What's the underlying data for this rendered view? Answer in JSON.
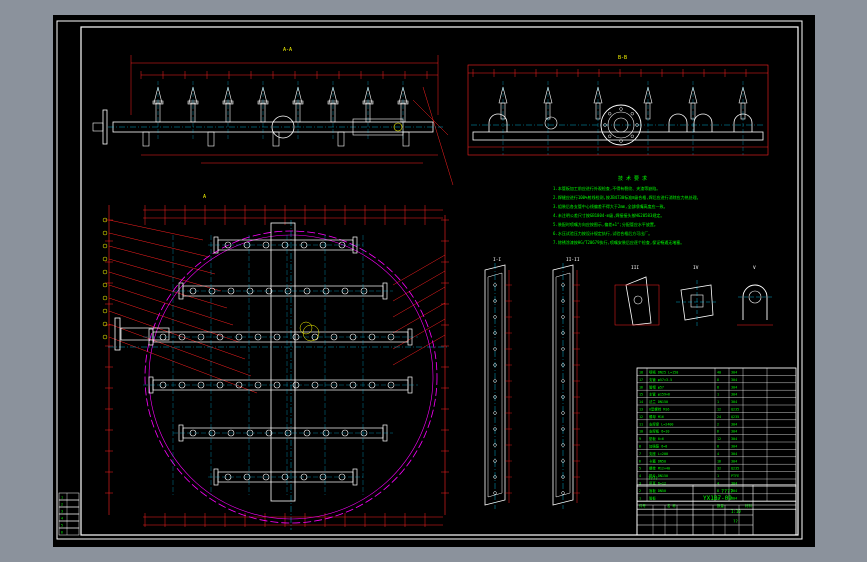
{
  "colors": {
    "background": "#000000",
    "frame": "#ffffff",
    "outline": "#ffffff",
    "dimension": "#ff2020",
    "center": "#00d0ff",
    "text": "#00ff00",
    "label": "#ffff00",
    "circle": "#ff00ff"
  },
  "views": {
    "front_label": "A-A",
    "side_label": "B-B",
    "plan_label": "A",
    "section1_label": "I-I",
    "section2_label": "II-II",
    "detail1_label": "III",
    "detail2_label": "IV",
    "detail3_label": "V"
  },
  "notes": {
    "title": "技 术 要 求",
    "lines": [
      "1.本管板加工前应进行外观检查,不得有裂纹、夹渣等缺陷。",
      "2.焊缝应进行100%射线检测,按JB4730标准Ⅱ级合格,焊后应进行消除应力热处理。",
      "3.组装后各支管中心线偏差不得大于2mm,全部喷嘴高度应一致。",
      "4.未注明公差尺寸按GB1804-m级,焊接接头按HG20583规定。",
      "5.装配时喷嘴方向应按图示,偏差±1°;分配管应水平放置。",
      "6.水压试验压力按设计规定执行,试验合格后方可出厂。",
      "7.除锈涂漆按HG/T20679执行,喷嘴安装后应逐个检查,保证畅通无堵塞。"
    ]
  },
  "title_block": {
    "drawing_no": "YX1B7-09",
    "drawing_title": "????",
    "scale": "1:10",
    "sheet": "????",
    "revision": "??",
    "rows": [
      {
        "no": "18",
        "name": "喷嘴 DN25 L=150",
        "qty": "40",
        "mat": "304"
      },
      {
        "no": "17",
        "name": "支管 φ57×3.5",
        "qty": "8",
        "mat": "304"
      },
      {
        "no": "16",
        "name": "管帽 φ57",
        "qty": "8",
        "mat": "304"
      },
      {
        "no": "15",
        "name": "主管 φ159×6",
        "qty": "1",
        "mat": "304"
      },
      {
        "no": "14",
        "name": "法兰 DN150",
        "qty": "1",
        "mat": "304"
      },
      {
        "no": "13",
        "name": "U型螺栓 M16",
        "qty": "12",
        "mat": "Q235"
      },
      {
        "no": "12",
        "name": "螺母 M16",
        "qty": "24",
        "mat": "Q235"
      },
      {
        "no": "11",
        "name": "支撑梁 L=2400",
        "qty": "2",
        "mat": "304"
      },
      {
        "no": "10",
        "name": "支撑板 δ=10",
        "qty": "6",
        "mat": "304"
      },
      {
        "no": "9",
        "name": "垫板 δ=6",
        "qty": "12",
        "mat": "304"
      },
      {
        "no": "8",
        "name": "加强筋 δ=8",
        "qty": "8",
        "mat": "304"
      },
      {
        "no": "7",
        "name": "支座 L=200",
        "qty": "4",
        "mat": "304"
      },
      {
        "no": "6",
        "name": "卡箍 DN50",
        "qty": "16",
        "mat": "304"
      },
      {
        "no": "5",
        "name": "螺栓 M12×40",
        "qty": "32",
        "mat": "Q235"
      },
      {
        "no": "4",
        "name": "垫片 DN150",
        "qty": "1",
        "mat": "PTFE"
      },
      {
        "no": "3",
        "name": "吊耳 δ=12",
        "qty": "4",
        "mat": "304"
      },
      {
        "no": "2",
        "name": "盲板 DN50",
        "qty": "8",
        "mat": "304"
      },
      {
        "no": "1",
        "name": "管板",
        "qty": "1",
        "mat": "304"
      }
    ],
    "header": {
      "no": "件号",
      "name": "名 称",
      "qty": "数量",
      "mat": "材料"
    }
  },
  "revision_table": {
    "cells": [
      "1",
      "2",
      "3",
      "4",
      "5",
      "6"
    ]
  }
}
